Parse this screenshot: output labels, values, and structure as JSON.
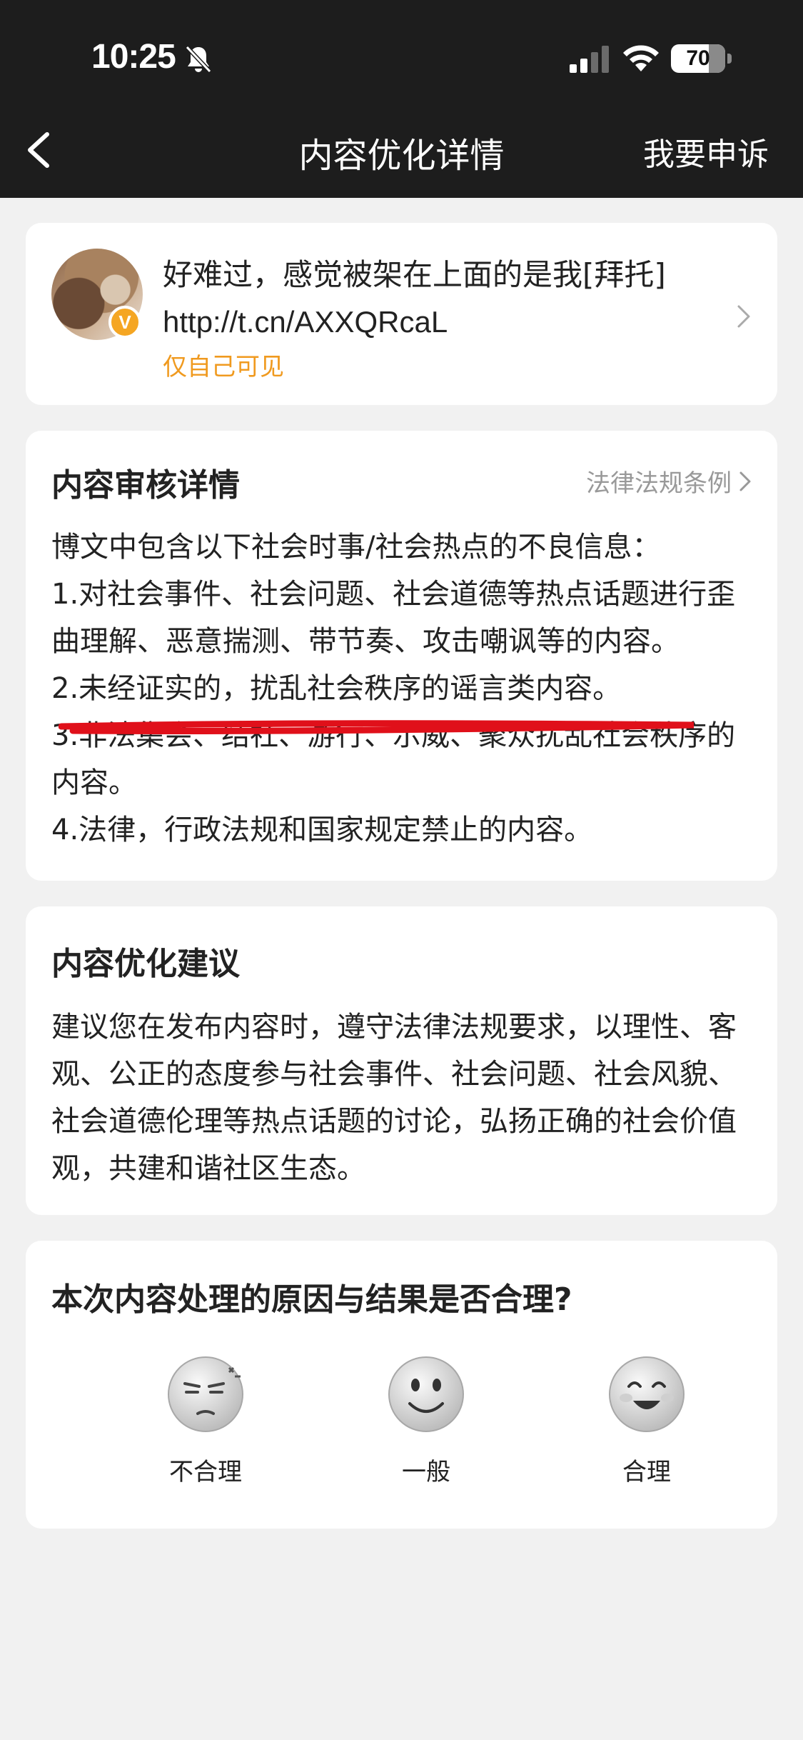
{
  "status_bar": {
    "time": "10:25",
    "battery": "70",
    "battery_level_percent": 70
  },
  "nav": {
    "title": "内容优化详情",
    "appeal_label": "我要申诉"
  },
  "post": {
    "text_line1": "好难过，感觉被架在上面的是我[拜托]",
    "link": "http://t.cn/AXXQRcaL",
    "visibility": "仅自己可见",
    "badge": "V"
  },
  "review": {
    "title": "内容审核详情",
    "law_link": "法律法规条例",
    "intro": "博文中包含以下社会时事/社会热点的不良信息：",
    "items": [
      "1.对社会事件、社会问题、社会道德等热点话题进行歪曲理解、恶意揣测、带节奏、攻击嘲讽等的内容。",
      "2.未经证实的，扰乱社会秩序的谣言类内容。",
      "3.非法集会、结社、游行、示威、聚众扰乱社会秩序的内容。",
      "4.法律，行政法规和国家规定禁止的内容。"
    ]
  },
  "advice": {
    "title": "内容优化建议",
    "body": "建议您在发布内容时，遵守法律法规要求，以理性、客观、公正的态度参与社会事件、社会问题、社会风貌、社会道德伦理等热点话题的讨论，弘扬正确的社会价值观，共建和谐社区生态。"
  },
  "feedback": {
    "question": "本次内容处理的原因与结果是否合理?",
    "options": [
      {
        "label": "不合理",
        "icon": "annoyed-face-icon"
      },
      {
        "label": "一般",
        "icon": "smile-face-icon"
      },
      {
        "label": "合理",
        "icon": "happy-face-icon"
      }
    ]
  },
  "colors": {
    "topbar": "#1d1d1d",
    "background": "#f1f1f1",
    "visibility_orange": "#f09a1f",
    "annotation_red": "#e0101a"
  }
}
